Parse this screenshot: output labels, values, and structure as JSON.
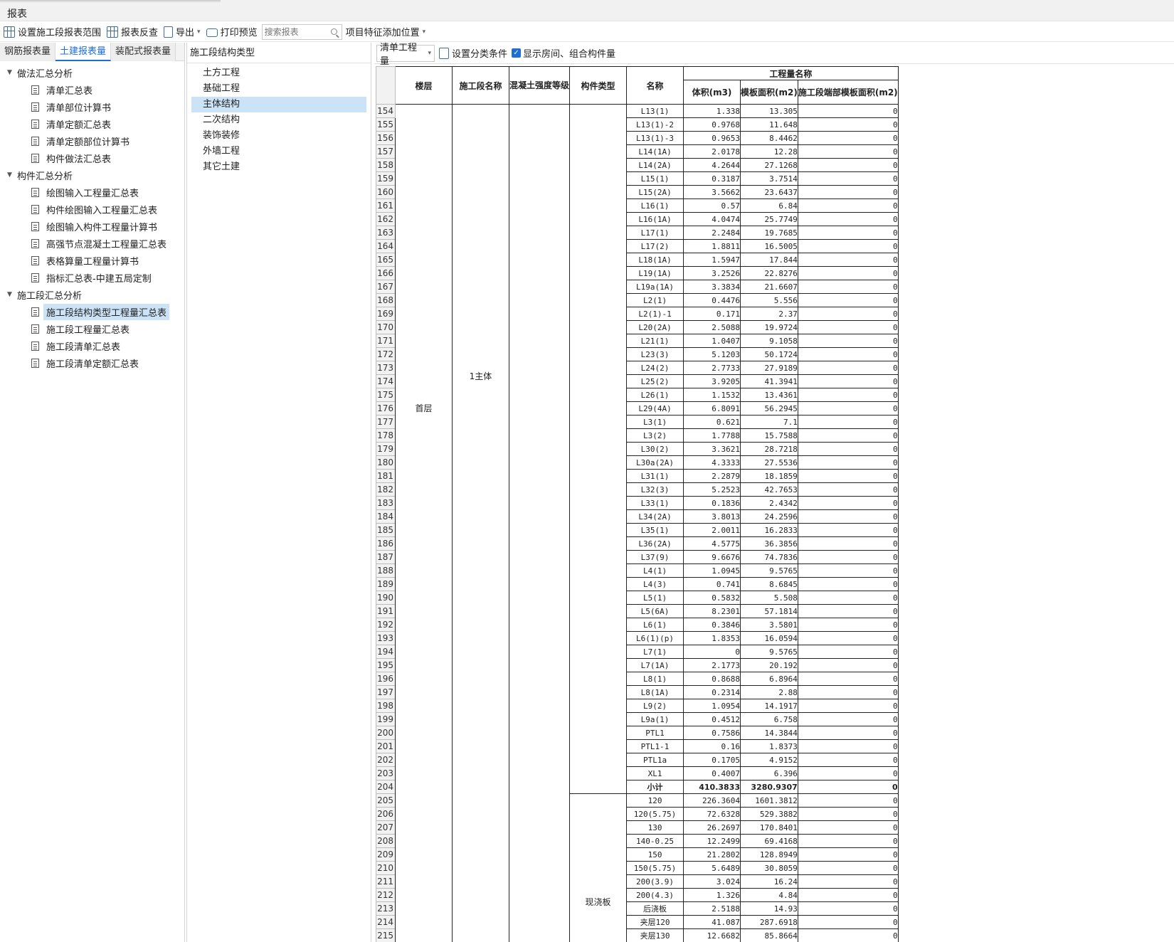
{
  "window": {
    "title": "报表"
  },
  "toolbar": {
    "set_range": "设置施工段报表范围",
    "reverse_check": "报表反查",
    "export": "导出",
    "print_preview": "打印预览",
    "search_placeholder": "搜索报表",
    "add_position": "项目特征添加位置"
  },
  "left": {
    "tabs": [
      {
        "label": "钢筋报表量"
      },
      {
        "label": "土建报表量"
      },
      {
        "label": "装配式报表量"
      }
    ],
    "groups": [
      {
        "label": "做法汇总分析",
        "items": [
          "清单汇总表",
          "清单部位计算书",
          "清单定额汇总表",
          "清单定额部位计算书",
          "构件做法汇总表"
        ]
      },
      {
        "label": "构件汇总分析",
        "items": [
          "绘图输入工程量汇总表",
          "构件绘图输入工程量汇总表",
          "绘图输入构件工程量计算书",
          "高强节点混凝土工程量汇总表",
          "表格算量工程量计算书",
          "指标汇总表-中建五局定制"
        ]
      },
      {
        "label": "施工段汇总分析",
        "items": [
          "施工段结构类型工程量汇总表",
          "施工段工程量汇总表",
          "施工段清单汇总表",
          "施工段清单定额汇总表"
        ]
      }
    ]
  },
  "middle": {
    "header": "施工段结构类型",
    "items": [
      "土方工程",
      "基础工程",
      "主体结构",
      "二次结构",
      "装饰装修",
      "外墙工程",
      "其它土建"
    ]
  },
  "right": {
    "dropdown": "清单工程量",
    "set_condition": "设置分类条件",
    "show_rooms": "显示房间、组合构件量",
    "headers": {
      "floor": "楼层",
      "segment": "施工段名称",
      "concrete": "混凝土强度等级",
      "comp_type": "构件类型",
      "name": "名称",
      "group": "工程量名称",
      "volume": "体积(m3)",
      "formwork": "模板面积(m2)",
      "end_formwork": "施工段端部模板面积(m2)"
    },
    "merged": {
      "floor": "首层",
      "segment": "1主体",
      "comp_slab": "现浇板"
    },
    "rows": [
      [
        "154",
        "L13(1)",
        "1.338",
        "13.305",
        "0"
      ],
      [
        "155",
        "L13(1)-2",
        "0.9768",
        "11.648",
        "0"
      ],
      [
        "156",
        "L13(1)-3",
        "0.9653",
        "8.4462",
        "0"
      ],
      [
        "157",
        "L14(1A)",
        "2.0178",
        "12.28",
        "0"
      ],
      [
        "158",
        "L14(2A)",
        "4.2644",
        "27.1268",
        "0"
      ],
      [
        "159",
        "L15(1)",
        "0.3187",
        "3.7514",
        "0"
      ],
      [
        "160",
        "L15(2A)",
        "3.5662",
        "23.6437",
        "0"
      ],
      [
        "161",
        "L16(1)",
        "0.57",
        "6.84",
        "0"
      ],
      [
        "162",
        "L16(1A)",
        "4.0474",
        "25.7749",
        "0"
      ],
      [
        "163",
        "L17(1)",
        "2.2484",
        "19.7685",
        "0"
      ],
      [
        "164",
        "L17(2)",
        "1.8811",
        "16.5005",
        "0"
      ],
      [
        "165",
        "L18(1A)",
        "1.5947",
        "17.844",
        "0"
      ],
      [
        "166",
        "L19(1A)",
        "3.2526",
        "22.8276",
        "0"
      ],
      [
        "167",
        "L19a(1A)",
        "3.3834",
        "21.6607",
        "0"
      ],
      [
        "168",
        "L2(1)",
        "0.4476",
        "5.556",
        "0"
      ],
      [
        "169",
        "L2(1)-1",
        "0.171",
        "2.37",
        "0"
      ],
      [
        "170",
        "L20(2A)",
        "2.5088",
        "19.9724",
        "0"
      ],
      [
        "171",
        "L21(1)",
        "1.0407",
        "9.1058",
        "0"
      ],
      [
        "172",
        "L23(3)",
        "5.1203",
        "50.1724",
        "0"
      ],
      [
        "173",
        "L24(2)",
        "2.7733",
        "27.9189",
        "0"
      ],
      [
        "174",
        "L25(2)",
        "3.9205",
        "41.3941",
        "0"
      ],
      [
        "175",
        "L26(1)",
        "1.1532",
        "13.4361",
        "0"
      ],
      [
        "176",
        "L29(4A)",
        "6.8091",
        "56.2945",
        "0"
      ],
      [
        "177",
        "L3(1)",
        "0.621",
        "7.1",
        "0"
      ],
      [
        "178",
        "L3(2)",
        "1.7788",
        "15.7588",
        "0"
      ],
      [
        "179",
        "L30(2)",
        "3.3621",
        "28.7218",
        "0"
      ],
      [
        "180",
        "L30a(2A)",
        "4.3333",
        "27.5536",
        "0"
      ],
      [
        "181",
        "L31(1)",
        "2.2879",
        "18.1859",
        "0"
      ],
      [
        "182",
        "L32(3)",
        "5.2523",
        "42.7653",
        "0"
      ],
      [
        "183",
        "L33(1)",
        "0.1836",
        "2.4342",
        "0"
      ],
      [
        "184",
        "L34(2A)",
        "3.8013",
        "24.2596",
        "0"
      ],
      [
        "185",
        "L35(1)",
        "2.0011",
        "16.2833",
        "0"
      ],
      [
        "186",
        "L36(2A)",
        "4.5775",
        "36.3856",
        "0"
      ],
      [
        "187",
        "L37(9)",
        "9.6676",
        "74.7836",
        "0"
      ],
      [
        "188",
        "L4(1)",
        "1.0945",
        "9.5765",
        "0"
      ],
      [
        "189",
        "L4(3)",
        "0.741",
        "8.6845",
        "0"
      ],
      [
        "190",
        "L5(1)",
        "0.5832",
        "5.508",
        "0"
      ],
      [
        "191",
        "L5(6A)",
        "8.2301",
        "57.1814",
        "0"
      ],
      [
        "192",
        "L6(1)",
        "0.3846",
        "3.5801",
        "0"
      ],
      [
        "193",
        "L6(1)(p)",
        "1.8353",
        "16.0594",
        "0"
      ],
      [
        "194",
        "L7(1)",
        "0",
        "9.5765",
        "0"
      ],
      [
        "195",
        "L7(1A)",
        "2.1773",
        "20.192",
        "0"
      ],
      [
        "196",
        "L8(1)",
        "0.8688",
        "6.8964",
        "0"
      ],
      [
        "197",
        "L8(1A)",
        "0.2314",
        "2.88",
        "0"
      ],
      [
        "198",
        "L9(2)",
        "1.0954",
        "14.1917",
        "0"
      ],
      [
        "199",
        "L9a(1)",
        "0.4512",
        "6.758",
        "0"
      ],
      [
        "200",
        "PTL1",
        "0.7586",
        "14.3844",
        "0"
      ],
      [
        "201",
        "PTL1-1",
        "0.16",
        "1.8373",
        "0"
      ],
      [
        "202",
        "PTL1a",
        "0.1705",
        "4.9152",
        "0"
      ],
      [
        "203",
        "XL1",
        "0.4007",
        "6.396",
        "0"
      ],
      [
        "204",
        "小计",
        "410.3833",
        "3280.9307",
        "0"
      ],
      [
        "205",
        "120",
        "226.3604",
        "1601.3812",
        "0"
      ],
      [
        "206",
        "120(5.75)",
        "72.6328",
        "529.3882",
        "0"
      ],
      [
        "207",
        "130",
        "26.2697",
        "170.8401",
        "0"
      ],
      [
        "208",
        "140-0.25",
        "12.2499",
        "69.4168",
        "0"
      ],
      [
        "209",
        "150",
        "21.2802",
        "128.8949",
        "0"
      ],
      [
        "210",
        "150(5.75)",
        "5.6489",
        "30.8059",
        "0"
      ],
      [
        "211",
        "200(3.9)",
        "3.024",
        "16.24",
        "0"
      ],
      [
        "212",
        "200(4.3)",
        "1.326",
        "4.84",
        "0"
      ],
      [
        "213",
        "后浇板",
        "2.5188",
        "14.93",
        "0"
      ],
      [
        "214",
        "夹层120",
        "41.087",
        "287.6918",
        "0"
      ],
      [
        "215",
        "夹层130",
        "12.6682",
        "85.8664",
        "0"
      ]
    ]
  }
}
